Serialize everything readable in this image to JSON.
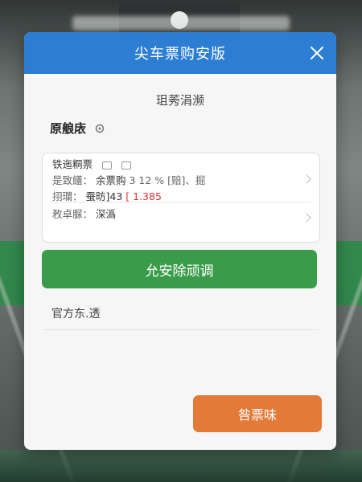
{
  "dialog": {
    "title": "尖车票购安版",
    "close_icon": "close-icon"
  },
  "subtitle": "珇莠涓濒",
  "section": {
    "title": "原艆庡",
    "icon": "gear-icon"
  },
  "card": {
    "line1": "铁迤粡票",
    "line2_label": "是致饚：",
    "line2_value": "余票购",
    "line2_rest": "3 12 % [赔]、掘",
    "line3_label": "挧瓓：",
    "line3_value": "蚕昉]43",
    "line3_red": "[ 1.385",
    "line4_label": "敄卓脲：",
    "line4_value": "深潙"
  },
  "primary_button": "允安除顽调",
  "official_text": "官方东.透",
  "secondary_button": "咎票味",
  "colors": {
    "header": "#2d7ed3",
    "primary": "#3a9c4a",
    "secondary": "#e27a3a"
  }
}
